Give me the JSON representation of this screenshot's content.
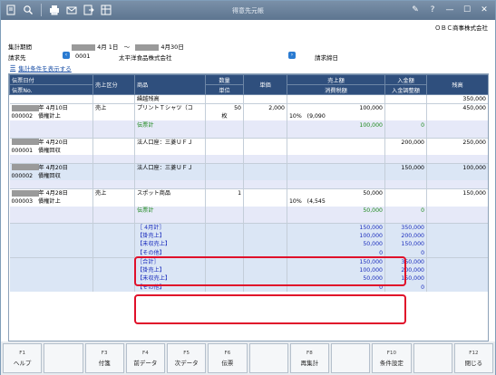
{
  "window": {
    "title": "得意先元帳"
  },
  "company": "ＯＢＣ商事株式会社",
  "header": {
    "period_label": "集計期間",
    "period_from": "4月 1日",
    "period_sep": "～",
    "period_to": "4月30日",
    "customer_label": "請求先",
    "customer_code": "0001",
    "customer_name": "太平洋食品株式会社",
    "closing_label": "請求締日",
    "filter_link": "集計条件を表示する"
  },
  "columns": {
    "date": "伝票日付",
    "slipno": "伝票No.",
    "type": "売上区分",
    "item": "商品",
    "qty": "数量",
    "unit": "単位",
    "price": "単価",
    "sales": "売上額",
    "tax": "消費税額",
    "receipt": "入金額",
    "adjust": "入金調整額",
    "balance": "残高"
  },
  "rows": {
    "carry": {
      "label": "繰越残高",
      "balance": "350,000"
    },
    "r1": {
      "date": "年  4月10日",
      "no": "000002",
      "kind": "債権計上",
      "type": "売上",
      "item": "プリントＴシャツ（コ",
      "qty": "50",
      "price": "2,000",
      "sales": "100,000",
      "balance": "450,000",
      "unit": "枚",
      "taxrate": "10%",
      "tax": "(9,090"
    },
    "r1sub": {
      "label": "伝票計",
      "sales": "100,000",
      "receipt": "0"
    },
    "r2": {
      "date": "年  4月20日",
      "no": "000001",
      "kind": "債権回収",
      "item": "法人口座：三菱ＵＦＪ",
      "receipt": "200,000",
      "balance": "250,000"
    },
    "r3": {
      "date": "年  4月20日",
      "no": "000002",
      "kind": "債権回収",
      "item": "法人口座：三菱ＵＦＪ",
      "receipt": "150,000",
      "balance": "100,000"
    },
    "r4": {
      "date": "年  4月28日",
      "no": "000003",
      "kind": "債権計上",
      "type": "売上",
      "item": "スポット商品",
      "qty": "1",
      "sales": "50,000",
      "balance": "150,000",
      "taxrate": "10%",
      "tax": "(4,545"
    },
    "r4sub": {
      "label": "伝票計",
      "sales": "50,000",
      "receipt": "0"
    },
    "month": {
      "label": "［ 4月計］",
      "sales": "150,000",
      "receipt": "350,000"
    },
    "m_kake": {
      "label": "【掛売上】",
      "sales": "100,000",
      "receipt": "200,000"
    },
    "m_mishu": {
      "label": "【未収売上】",
      "sales": "50,000",
      "receipt": "150,000"
    },
    "m_other": {
      "label": "【その他】",
      "sales": "0",
      "receipt": "0"
    },
    "total": {
      "label": "［合計］",
      "sales": "150,000",
      "receipt": "350,000"
    },
    "t_kake": {
      "label": "【掛売上】",
      "sales": "100,000",
      "receipt": "200,000"
    },
    "t_mishu": {
      "label": "【未収売上】",
      "sales": "50,000",
      "receipt": "150,000"
    },
    "t_other": {
      "label": "【その他】",
      "sales": "0",
      "receipt": "0"
    }
  },
  "fkeys": [
    {
      "key": "F1",
      "label": "ヘルプ"
    },
    {
      "key": "",
      "label": ""
    },
    {
      "key": "F3",
      "label": "付箋"
    },
    {
      "key": "F4",
      "label": "前データ"
    },
    {
      "key": "F5",
      "label": "次データ"
    },
    {
      "key": "F6",
      "label": "伝票"
    },
    {
      "key": "",
      "label": ""
    },
    {
      "key": "F8",
      "label": "再集計"
    },
    {
      "key": "",
      "label": ""
    },
    {
      "key": "F10",
      "label": "条件設定"
    },
    {
      "key": "",
      "label": ""
    },
    {
      "key": "F12",
      "label": "閉じる"
    }
  ]
}
